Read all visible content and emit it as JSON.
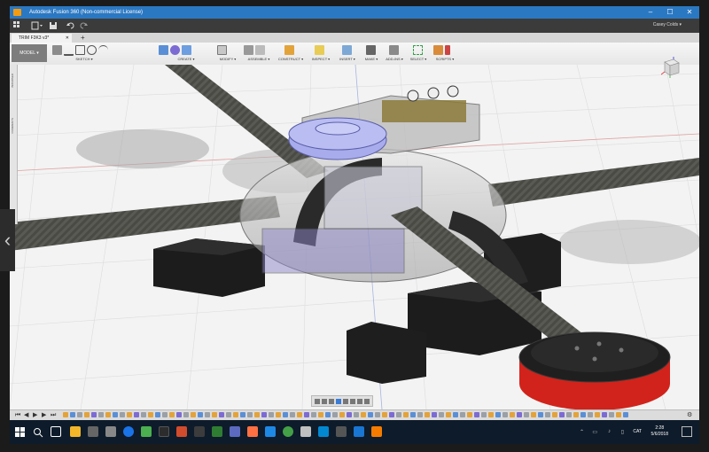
{
  "window": {
    "title": "Autodesk Fusion 360 (Non-commercial License)",
    "controls": [
      "–",
      "☐",
      "✕"
    ]
  },
  "quick_access": {
    "grid_icon": "grid-icon",
    "file_icon": "file-icon",
    "save_icon": "save-icon",
    "undo_icon": "undo-icon",
    "redo_icon": "redo-icon",
    "user_name": "Casey Colds ▾"
  },
  "document_tab": {
    "label": "TRIM F3K3 v3*",
    "close": "✕",
    "add": "+"
  },
  "ribbon": {
    "workspace_label": "MODEL ▾",
    "groups": [
      {
        "label": "SKETCH ▾"
      },
      {
        "label": "CREATE ▾"
      },
      {
        "label": "MODIFY ▾"
      },
      {
        "label": "ASSEMBLE ▾"
      },
      {
        "label": "CONSTRUCT ▾"
      },
      {
        "label": "INSPECT ▾"
      },
      {
        "label": "INSERT ▾"
      },
      {
        "label": "MAKE ▾"
      },
      {
        "label": "ADD-INS ▾"
      },
      {
        "label": "SELECT ▾"
      },
      {
        "label": "SCRIPTS ▾"
      }
    ]
  },
  "left_panel": {
    "browser_label": "BROWSER",
    "comments_label": "COMMENTS"
  },
  "viewcube": {
    "face_label": "FRONT"
  },
  "timeline": {
    "controls": [
      "⏮",
      "◀",
      "▶",
      "▶",
      "⏭"
    ]
  },
  "taskbar": {
    "language": "CAT",
    "time": "2:28",
    "date": "5/6/2018"
  },
  "colors": {
    "accent": "#2b78c2",
    "taskbar": "#0e1b2a",
    "selection_blue": "#a9acec"
  }
}
